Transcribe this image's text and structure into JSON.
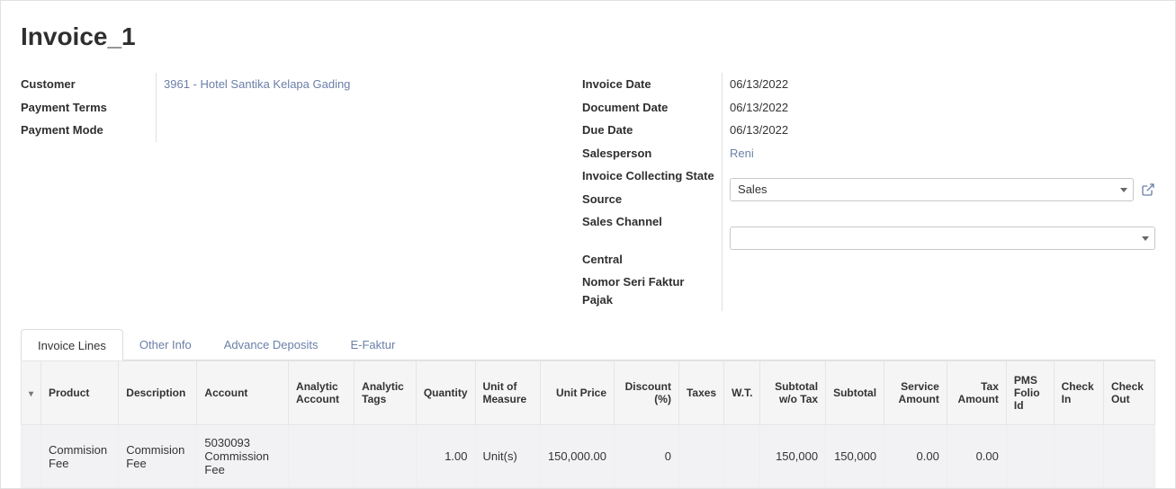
{
  "title": "Invoice_1",
  "left_fields": {
    "customer_label": "Customer",
    "customer_value": "3961 - Hotel Santika Kelapa Gading",
    "payment_terms_label": "Payment Terms",
    "payment_terms_value": "",
    "payment_mode_label": "Payment Mode",
    "payment_mode_value": ""
  },
  "right_fields": {
    "invoice_date_label": "Invoice Date",
    "invoice_date_value": "06/13/2022",
    "document_date_label": "Document Date",
    "document_date_value": "06/13/2022",
    "due_date_label": "Due Date",
    "due_date_value": "06/13/2022",
    "salesperson_label": "Salesperson",
    "salesperson_value": "Reni",
    "collecting_state_label": "Invoice Collecting State",
    "collecting_state_value": "",
    "source_label": "Source",
    "source_value": "",
    "sales_channel_label": "Sales Channel",
    "sales_channel_value": "Sales",
    "central_label": "Central",
    "central_value": "",
    "nomor_label": "Nomor Seri Faktur Pajak",
    "nomor_value": ""
  },
  "tabs": {
    "invoice_lines": "Invoice Lines",
    "other_info": "Other Info",
    "advance_deposits": "Advance Deposits",
    "efaktur": "E-Faktur"
  },
  "columns": {
    "product": "Product",
    "description": "Description",
    "account": "Account",
    "analytic_account": "Analytic Account",
    "analytic_tags": "Analytic Tags",
    "quantity": "Quantity",
    "uom": "Unit of Measure",
    "unit_price": "Unit Price",
    "discount": "Discount (%)",
    "taxes": "Taxes",
    "wt": "W.T.",
    "subtotal_wo_tax": "Subtotal w/o Tax",
    "subtotal": "Subtotal",
    "service_amount": "Service Amount",
    "tax_amount": "Tax Amount",
    "pms_folio": "PMS Folio Id",
    "check_in": "Check In",
    "check_out": "Check Out"
  },
  "rows": [
    {
      "product": "Commision Fee",
      "description": "Commision Fee",
      "account": "5030093 Commission Fee",
      "analytic_account": "",
      "analytic_tags": "",
      "quantity": "1.00",
      "uom": "Unit(s)",
      "unit_price": "150,000.00",
      "discount": "0",
      "taxes": "",
      "wt": "",
      "subtotal_wo_tax": "150,000",
      "subtotal": "150,000",
      "service_amount": "0.00",
      "tax_amount": "0.00",
      "pms_folio": "",
      "check_in": "",
      "check_out": ""
    }
  ]
}
